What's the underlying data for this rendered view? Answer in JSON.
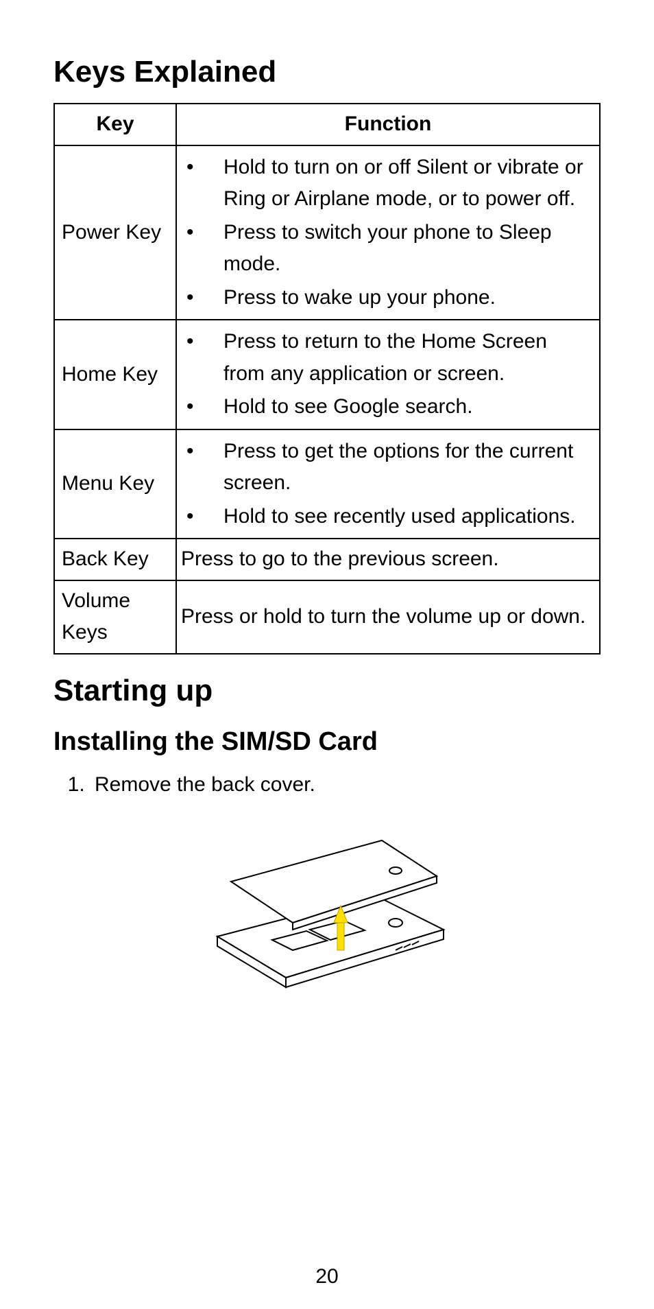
{
  "sections": {
    "keys_heading": "Keys Explained",
    "starting_heading": "Starting up",
    "sim_heading": "Installing the SIM/SD Card"
  },
  "table": {
    "headers": {
      "key": "Key",
      "function": "Function"
    },
    "rows": [
      {
        "key": "Power Key",
        "bullets": [
          "Hold to turn on or off Silent or vibrate or Ring or Airplane mode, or to power off.",
          "Press to switch your phone to Sleep mode.",
          "Press to wake up your phone."
        ]
      },
      {
        "key": "Home Key",
        "bullets": [
          "Press to return to the Home Screen from any application or screen.",
          "Hold to see Google search."
        ]
      },
      {
        "key": "Menu Key",
        "bullets": [
          "Press to get the options for the current screen.",
          "Hold to see recently used applications."
        ]
      },
      {
        "key": "Back Key",
        "text": "Press to go to the previous screen."
      },
      {
        "key": "Volume Keys",
        "text": "Press or hold to turn the volume up or down."
      }
    ]
  },
  "steps": [
    "Remove the back cover."
  ],
  "illustration_alt": "Phone with back cover being lifted, yellow arrow indicating removal direction",
  "page_number": "20"
}
